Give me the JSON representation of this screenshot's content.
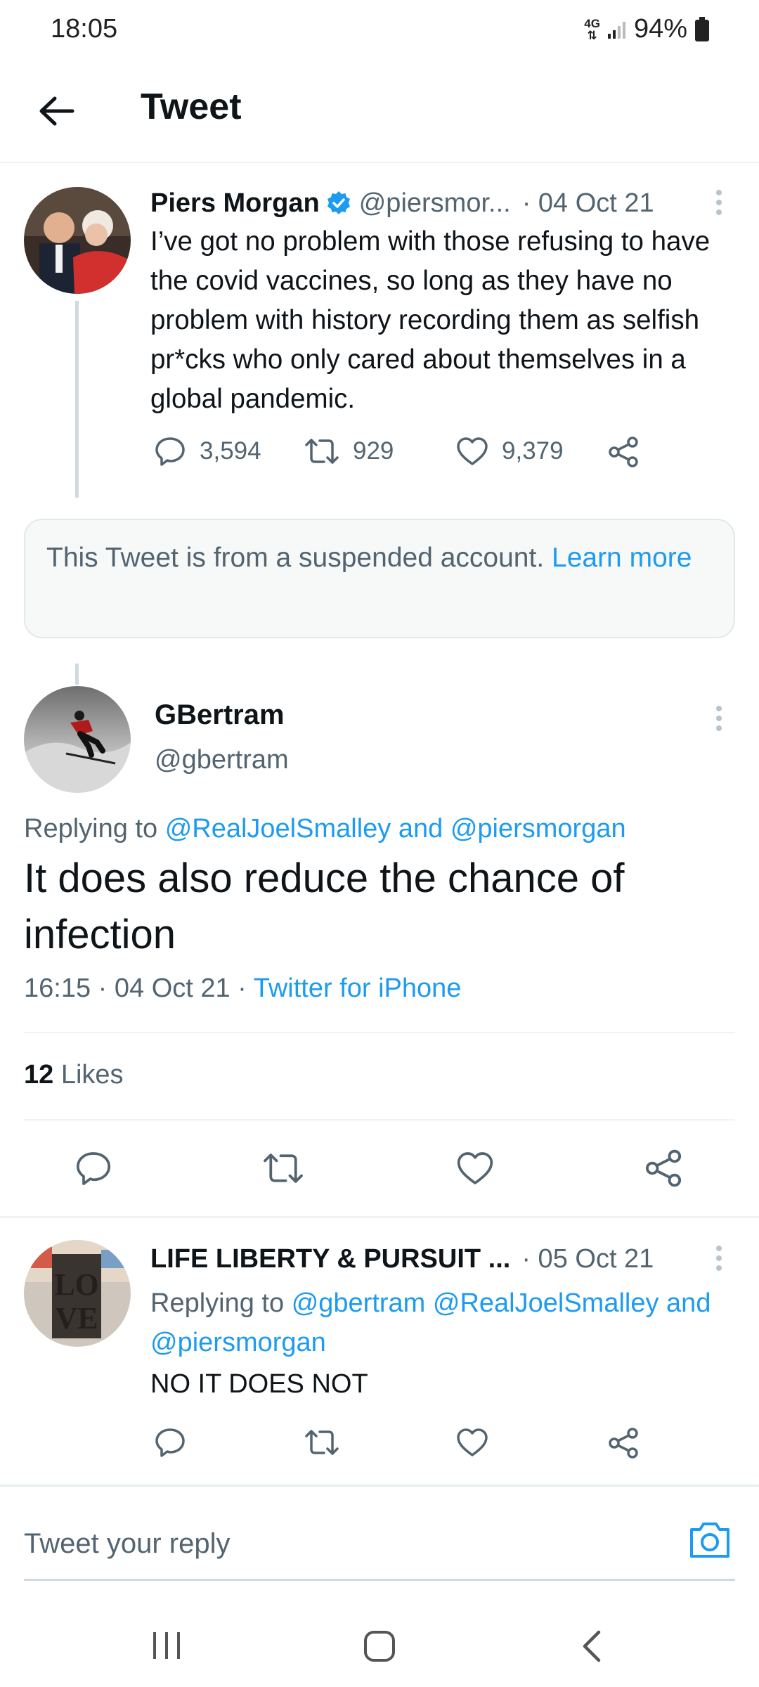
{
  "status": {
    "time": "18:05",
    "network": "4G",
    "battery": "94%"
  },
  "header": {
    "title": "Tweet"
  },
  "tweet1": {
    "name": "Piers Morgan",
    "handle": "@piersmor...",
    "date": "· 04 Oct 21",
    "text": "I’ve got no problem with those refusing to have the covid vaccines, so long as they have no problem with history recording them as selfish pr*cks who only cared about themselves in a global pandemic.",
    "replies": "3,594",
    "retweets": "929",
    "likes": "9,379"
  },
  "notice": {
    "text": "This Tweet is from a suspended account.",
    "link": "Learn more"
  },
  "main_tweet": {
    "name": "GBertram",
    "handle": "@gbertram",
    "replying_prefix": "Replying to",
    "replying_to_1": "@RealJoelSmalley",
    "replying_and": "and",
    "replying_to_2": "@piersmorgan",
    "text": "It does also reduce the chance of infection",
    "timestamp": "16:15 · 04 Oct 21 ·",
    "source": "Twitter for iPhone",
    "likes_count": "12",
    "likes_label": "Likes"
  },
  "reply": {
    "name": "LIFE LIBERTY & PURSUIT ...",
    "date": "· 05 Oct 21",
    "replying_prefix": "Replying to",
    "replying_to_1": "@gbertram",
    "replying_to_2": "@RealJoelSmalley",
    "replying_and": "and",
    "replying_to_3": "@piersmorgan",
    "text": "NO IT DOES NOT"
  },
  "compose": {
    "placeholder": "Tweet your reply"
  },
  "colors": {
    "accent": "#1d9bf0",
    "muted": "#536471",
    "text": "#0f1419"
  }
}
